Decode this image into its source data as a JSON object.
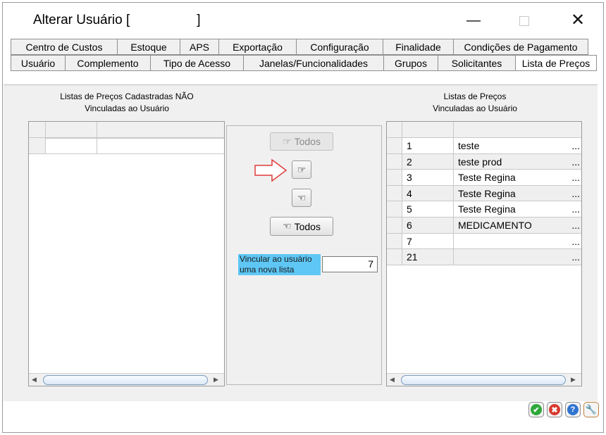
{
  "window": {
    "title": "Alterar Usuário [                  ]",
    "minimize_glyph": "—",
    "close_glyph": "✕"
  },
  "tabs_row1": [
    {
      "label": "Centro de Custos"
    },
    {
      "label": "Estoque"
    },
    {
      "label": "APS"
    },
    {
      "label": "Exportação"
    },
    {
      "label": "Configuração"
    },
    {
      "label": "Finalidade"
    },
    {
      "label": "Condições de Pagamento"
    }
  ],
  "tabs_row2": [
    {
      "label": "Usuário"
    },
    {
      "label": "Complemento"
    },
    {
      "label": "Tipo de Acesso"
    },
    {
      "label": "Janelas/Funcionalidades"
    },
    {
      "label": "Grupos"
    },
    {
      "label": "Solicitantes"
    },
    {
      "label": "Lista de Preços",
      "active": true
    }
  ],
  "left_panel": {
    "title_line1": "Listas de Preços Cadastradas NÃO",
    "title_line2": "Vinculadas ao Usuário"
  },
  "right_panel": {
    "title_line1": "Listas de Preços",
    "title_line2": "Vinculadas ao Usuário",
    "rows": [
      {
        "id": "1",
        "name": "teste",
        "more": "..."
      },
      {
        "id": "2",
        "name": "teste prod",
        "more": "..."
      },
      {
        "id": "3",
        "name": "Teste Regina",
        "more": "..."
      },
      {
        "id": "4",
        "name": "Teste Regina",
        "more": "..."
      },
      {
        "id": "5",
        "name": "Teste Regina",
        "more": "..."
      },
      {
        "id": "6",
        "name": "MEDICAMENTO",
        "more": "..."
      },
      {
        "id": "7",
        "name": "",
        "more": "..."
      },
      {
        "id": "21",
        "name": "",
        "more": "..."
      }
    ]
  },
  "middle": {
    "all_right_label": "Todos",
    "all_left_label": "Todos",
    "link_label": "Vincular ao usuário uma nova lista",
    "link_value": "7"
  },
  "icons": {
    "pointing_hand": "☞",
    "pointing_hand_left": "☜",
    "ok": "✔",
    "cancel": "✖",
    "help": "?",
    "tools": "🔧"
  },
  "colors": {
    "highlight_label": "#5ec7f5",
    "ok_green": "#2fa83a",
    "cancel_red": "#d83a2f",
    "help_blue": "#2f74d0",
    "tools_orange": "#e08a1a",
    "arrow_red": "#e03a3a"
  }
}
